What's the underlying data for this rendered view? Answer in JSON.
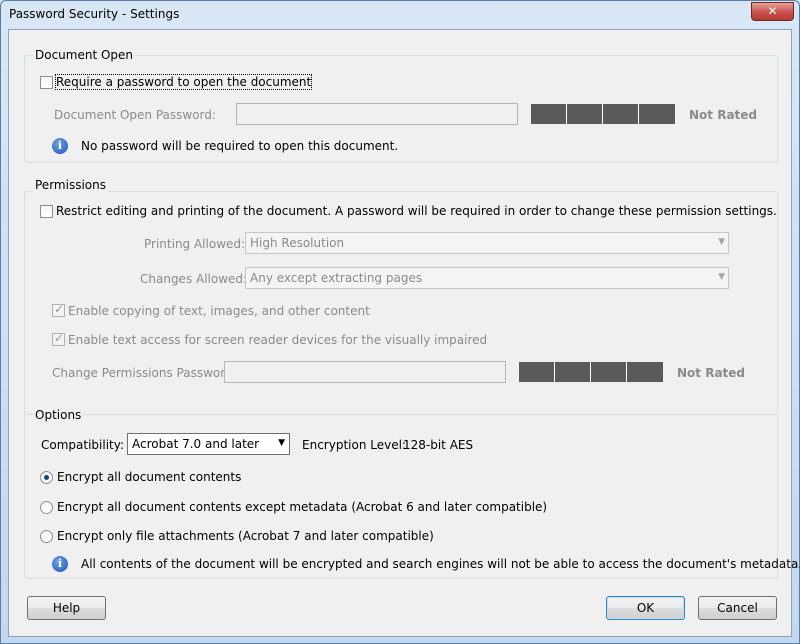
{
  "window": {
    "title": "Password Security - Settings",
    "close_label": "✕"
  },
  "document_open": {
    "section_label": "Document Open",
    "require_password_label": "Require a password to open the document",
    "require_password_checked": false,
    "password_label": "Document Open Password:",
    "password_value": "",
    "rating": "Not Rated",
    "info_text": "No password will be required to open this document."
  },
  "permissions": {
    "section_label": "Permissions",
    "restrict_label": "Restrict editing and printing of the document. A password will be required in order to change these permission settings.",
    "restrict_checked": false,
    "printing_label": "Printing Allowed:",
    "printing_value": "High Resolution",
    "changes_label": "Changes Allowed:",
    "changes_value": "Any except extracting pages",
    "copy_label": "Enable copying of text, images, and other content",
    "copy_checked": true,
    "screen_reader_label": "Enable text access for screen reader devices for the visually impaired",
    "screen_reader_checked": true,
    "change_password_label": "Change Permissions Password:",
    "change_password_value": "",
    "rating": "Not Rated"
  },
  "options": {
    "section_label": "Options",
    "compatibility_label": "Compatibility:",
    "compatibility_value": "Acrobat 7.0 and later",
    "encryption_label": "Encryption  Level:",
    "encryption_value": "128-bit AES",
    "radio_all": "Encrypt all document contents",
    "radio_except_metadata": "Encrypt all document contents except metadata (Acrobat 6 and later compatible)",
    "radio_attachments": "Encrypt only file attachments (Acrobat 7 and later compatible)",
    "selected": "radio_all",
    "info_text": "All contents of the document will be encrypted and search engines will not be able to access the document's metadata."
  },
  "buttons": {
    "help": "Help",
    "ok": "OK",
    "cancel": "Cancel"
  },
  "icons": {
    "info": "info-icon",
    "dropdown": "chevron-down-icon",
    "close": "close-icon"
  }
}
